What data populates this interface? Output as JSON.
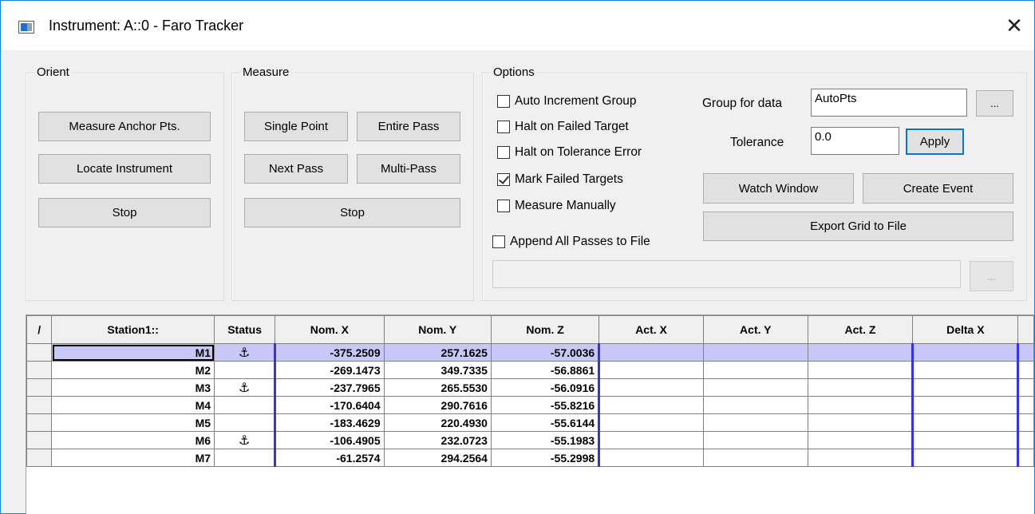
{
  "window": {
    "title": "Instrument: A::0 - Faro Tracker",
    "close_glyph": "✕"
  },
  "orient": {
    "label": "Orient",
    "measure_anchor": "Measure Anchor Pts.",
    "locate_instrument": "Locate Instrument",
    "stop": "Stop"
  },
  "measure": {
    "label": "Measure",
    "single_point": "Single Point",
    "entire_pass": "Entire Pass",
    "next_pass": "Next Pass",
    "multi_pass": "Multi-Pass",
    "stop": "Stop"
  },
  "options": {
    "label": "Options",
    "checkboxes": [
      {
        "label": "Auto Increment Group",
        "checked": false
      },
      {
        "label": "Halt on Failed Target",
        "checked": false
      },
      {
        "label": "Halt on Tolerance Error",
        "checked": false
      },
      {
        "label": "Mark Failed Targets",
        "checked": true
      },
      {
        "label": "Measure Manually",
        "checked": false
      }
    ],
    "append_all": {
      "label": "Append All Passes to File",
      "checked": false
    },
    "group_for_data_label": "Group for data",
    "group_for_data_value": "AutoPts",
    "browse_group": "...",
    "tolerance_label": "Tolerance",
    "tolerance_value": "0.0",
    "apply": "Apply",
    "watch_window": "Watch Window",
    "create_event": "Create Event",
    "export_grid": "Export Grid to File",
    "file_path_value": "",
    "browse_file": "..."
  },
  "grid": {
    "corner": "/",
    "columns": [
      "Station1::",
      "Status",
      "Nom. X",
      "Nom. Y",
      "Nom. Z",
      "Act. X",
      "Act. Y",
      "Act. Z",
      "Delta X"
    ],
    "rows": [
      {
        "name": "M1",
        "status": "⚓",
        "nom_x": "-375.2509",
        "nom_y": "257.1625",
        "nom_z": "-57.0036"
      },
      {
        "name": "M2",
        "status": "",
        "nom_x": "-269.1473",
        "nom_y": "349.7335",
        "nom_z": "-56.8861"
      },
      {
        "name": "M3",
        "status": "⚓",
        "nom_x": "-237.7965",
        "nom_y": "265.5530",
        "nom_z": "-56.0916"
      },
      {
        "name": "M4",
        "status": "",
        "nom_x": "-170.6404",
        "nom_y": "290.7616",
        "nom_z": "-55.8216"
      },
      {
        "name": "M5",
        "status": "",
        "nom_x": "-183.4629",
        "nom_y": "220.4930",
        "nom_z": "-55.6144"
      },
      {
        "name": "M6",
        "status": "⚓",
        "nom_x": "-106.4905",
        "nom_y": "232.0723",
        "nom_z": "-55.1983"
      },
      {
        "name": "M7",
        "status": "",
        "nom_x": "-61.2574",
        "nom_y": "294.2564",
        "nom_z": "-55.2998"
      }
    ],
    "selected_row": 0
  },
  "colors": {
    "selection": "#c8c8f8",
    "column_divider": "#3333ee",
    "window_border": "#1883d7"
  }
}
